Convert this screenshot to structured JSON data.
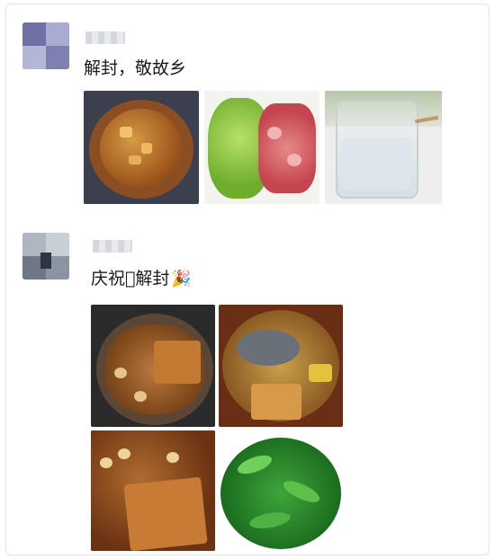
{
  "posts": [
    {
      "text": "解封，敬故乡",
      "photos": [
        "stew-pot-photo",
        "pepper-sausage-photo",
        "liquor-glass-photo"
      ]
    },
    {
      "text": "庆祝􀀀解封",
      "emoji": "🎉",
      "photos": [
        "braised-tofu-photo",
        "fish-stew-photo",
        "tofu-peanut-photo",
        "greens-photo"
      ]
    }
  ]
}
